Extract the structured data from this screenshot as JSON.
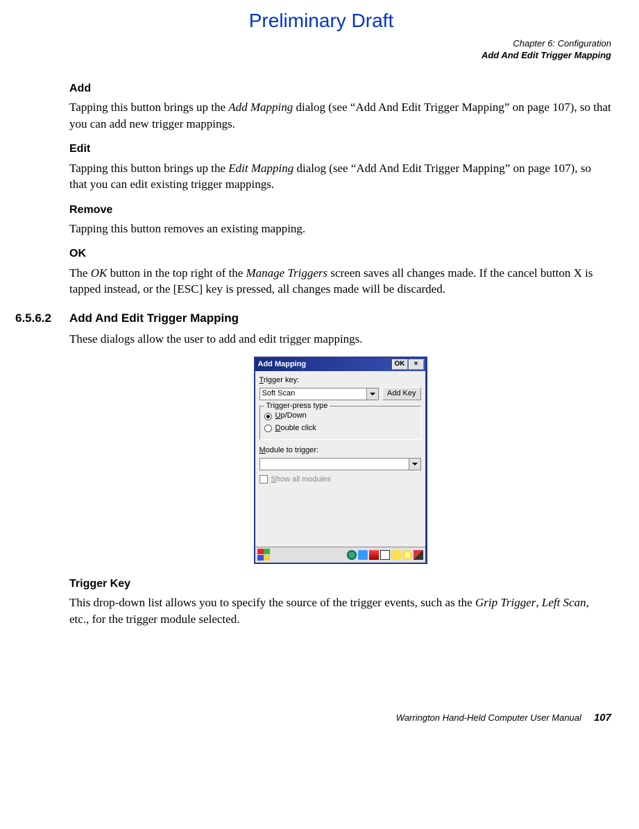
{
  "header": {
    "draft": "Preliminary Draft",
    "chapter": "Chapter 6: Configuration",
    "section": "Add And Edit Trigger Mapping"
  },
  "sections": {
    "add": {
      "title": "Add",
      "text_a": "Tapping this button brings up the ",
      "text_b": "Add Mapping",
      "text_c": " dialog (see “Add And Edit Trigger Mapping” on page 107), so that you can add new trigger mappings."
    },
    "edit": {
      "title": "Edit",
      "text_a": "Tapping this button brings up the ",
      "text_b": "Edit Mapping",
      "text_c": " dialog (see “Add And Edit Trigger Mapping” on page 107), so that you can edit existing trigger mappings."
    },
    "remove": {
      "title": "Remove",
      "text": "Tapping this button removes an existing mapping."
    },
    "ok": {
      "title": "OK",
      "text_a": "The ",
      "text_b": "OK",
      "text_c": " button in the top right of the ",
      "text_d": "Manage Triggers",
      "text_e": " screen saves all changes made. If the cancel button X is tapped instead, or the [ESC] key is pressed, all changes made will be discarded."
    },
    "main": {
      "number": "6.5.6.2",
      "title": "Add And Edit Trigger Mapping",
      "intro": "These dialogs allow the user to add and edit trigger mappings."
    },
    "trigger_key": {
      "title": "Trigger Key",
      "text_a": "This drop-down list allows you to specify the source of the trigger events, such as the ",
      "text_b": "Grip Trigger",
      "text_c": ", ",
      "text_d": "Left Scan",
      "text_e": ", etc., for the trigger module selected."
    }
  },
  "dialog": {
    "title": "Add Mapping",
    "ok": "OK",
    "close": "×",
    "trigger_label_pre": "T",
    "trigger_label": "rigger key:",
    "trigger_value": "Soft Scan",
    "add_key_btn": "Add Key",
    "press_type_legend": "Trigger-press type",
    "radio1_pre": "U",
    "radio1": "p/Down",
    "radio2_pre": "D",
    "radio2": "ouble click",
    "module_label_pre": "M",
    "module_label": "odule to trigger:",
    "show_all_pre": "S",
    "show_all": "how all modules"
  },
  "footer": {
    "manual": "Warrington Hand-Held Computer User Manual",
    "page": "107"
  }
}
